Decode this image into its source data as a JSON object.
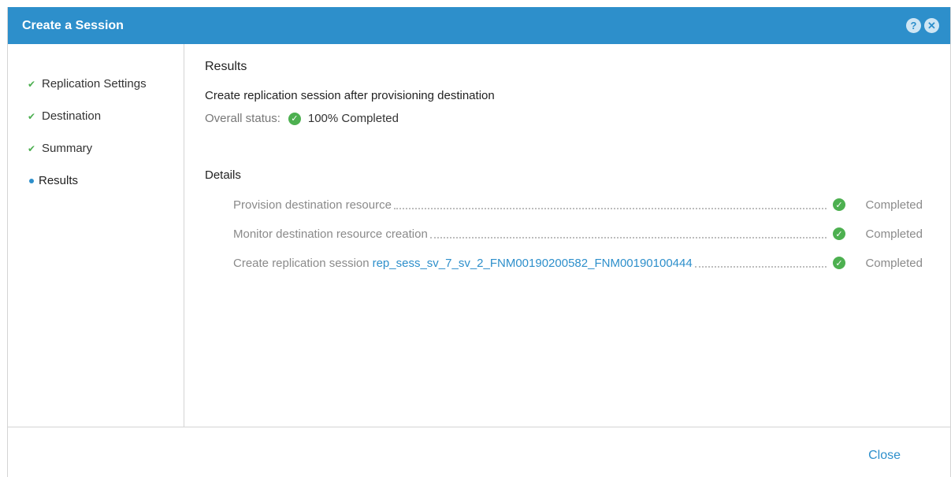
{
  "window": {
    "title": "Create a Session",
    "help_icon": "help-icon",
    "close_icon": "close-icon"
  },
  "sidebar": {
    "steps": [
      {
        "label": "Replication Settings",
        "state": "done"
      },
      {
        "label": "Destination",
        "state": "done"
      },
      {
        "label": "Summary",
        "state": "done"
      },
      {
        "label": "Results",
        "state": "active"
      }
    ]
  },
  "main": {
    "heading": "Results",
    "operation_title": "Create replication session after provisioning destination",
    "overall_label": "Overall status:",
    "overall_value": "100% Completed",
    "details_heading": "Details",
    "details": [
      {
        "text": "Provision destination resource",
        "link": "",
        "status": "Completed"
      },
      {
        "text": "Monitor destination resource creation",
        "link": "",
        "status": "Completed"
      },
      {
        "text": "Create replication session",
        "link": "rep_sess_sv_7_sv_2_FNM00190200582_FNM00190100444",
        "status": "Completed"
      }
    ]
  },
  "footer": {
    "close_label": "Close"
  },
  "colors": {
    "titlebar": "#2d8fcb",
    "success": "#4db050",
    "link": "#2d8fcb"
  }
}
